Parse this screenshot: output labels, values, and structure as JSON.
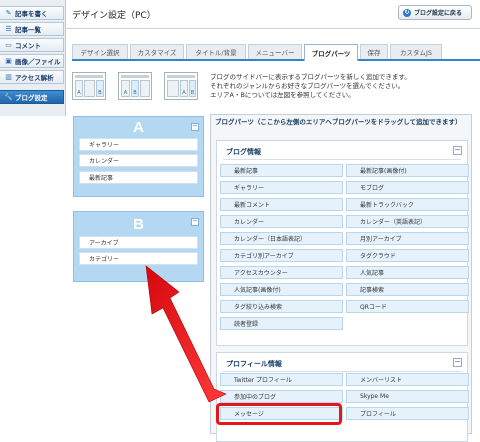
{
  "sidebar": {
    "items": [
      {
        "label": "記事を書く",
        "icon": "pencil-icon",
        "active": false
      },
      {
        "label": "記事一覧",
        "icon": "list-icon",
        "active": false
      },
      {
        "label": "コメント",
        "icon": "comment-icon",
        "active": false
      },
      {
        "label": "画像／ファイル",
        "icon": "image-icon",
        "active": false
      },
      {
        "label": "アクセス解析",
        "icon": "chart-icon",
        "active": false
      },
      {
        "label": "ブログ設定",
        "icon": "wrench-icon",
        "active": true
      }
    ]
  },
  "header": {
    "title": "デザイン設定（PC）",
    "back_label": "ブログ設定に戻る",
    "back_icon": "refresh-icon"
  },
  "tabs": [
    {
      "label": "デザイン選択",
      "active": false
    },
    {
      "label": "カスタマイズ",
      "active": false
    },
    {
      "label": "タイトル/背景",
      "active": false
    },
    {
      "label": "メニューバー",
      "active": false
    },
    {
      "label": "ブログパーツ",
      "active": true
    },
    {
      "label": "保存",
      "active": false
    },
    {
      "label": "カスタムJS",
      "active": false
    }
  ],
  "intro": {
    "layout_labels": {
      "a": "A",
      "b": "B"
    },
    "line1": "ブログのサイドバーに表示するブログパーツを新しく追加できます。",
    "line2": "それぞれのジャンルからお好きなブログパーツを選んでください。",
    "line3": "エリアA・Bについては左図を参照してください。"
  },
  "areas": {
    "a": {
      "label": "A",
      "collapse": "−",
      "parts": [
        "ギャラリー",
        "カレンダー",
        "最新記事"
      ]
    },
    "b": {
      "label": "B",
      "collapse": "−",
      "parts": [
        "アーカイブ",
        "カテゴリー"
      ]
    }
  },
  "parts_panel": {
    "title": "ブログパーツ（ここから左側のエリアへブログパーツをドラッグして追加できます）",
    "groups": [
      {
        "title": "ブログ情報",
        "collapse": "−",
        "items": [
          "最新記事",
          "最新記事(画像付)",
          "ギャラリー",
          "モブログ",
          "最新コメント",
          "最新トラックバック",
          "カレンダー",
          "カレンダー（英語表記）",
          "カレンダー（日本語表記）",
          "月別アーカイブ",
          "カテゴリ別アーカイブ",
          "タグクラウド",
          "アクセスカウンター",
          "人気記事",
          "人気記事(画像付)",
          "記事検索",
          "タグ絞り込み検索",
          "QRコード",
          "読者登録"
        ]
      },
      {
        "title": "プロフィール情報",
        "collapse": "−",
        "items": [
          "Twitter プロフィール",
          "メンバーリスト",
          "参加中のブログ",
          "Skype Me",
          "メッセージ",
          "プロフィール"
        ]
      }
    ]
  },
  "colors": {
    "accent": "#2f86cf",
    "highlight": "#e8141c",
    "area_bg": "#b5d8f2"
  }
}
